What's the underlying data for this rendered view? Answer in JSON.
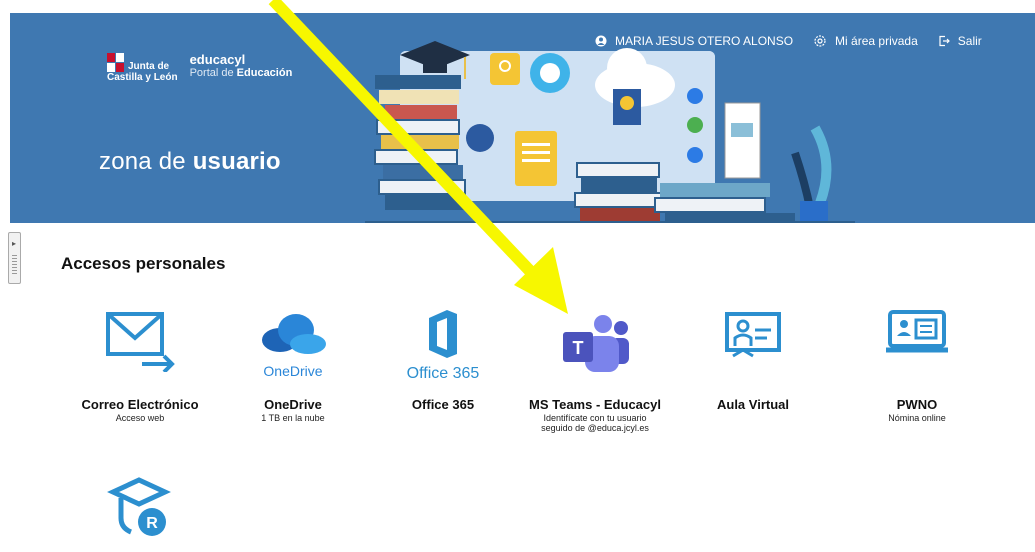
{
  "header": {
    "brand_line1": "Junta de",
    "brand_line2": "Castilla y León",
    "portal_name": "educacyl",
    "portal_sub_prefix": "Portal de ",
    "portal_sub_bold": "Educación",
    "zona_prefix": "zona de ",
    "zona_bold": "usuario"
  },
  "topbar": {
    "user_name": "MARIA JESUS OTERO ALONSO",
    "private_area": "Mi área privada",
    "logout": "Salir"
  },
  "section": {
    "title": "Accesos personales"
  },
  "tiles": [
    {
      "name": "Correo Electrónico",
      "sub": "Acceso web",
      "icon": "mail-send-icon"
    },
    {
      "name": "OneDrive",
      "sub": "1 TB en la nube",
      "icon": "onedrive-icon",
      "icon_text": "OneDrive"
    },
    {
      "name": "Office 365",
      "sub": "",
      "icon": "office365-icon",
      "icon_text": "Office 365"
    },
    {
      "name": "MS Teams - Educacyl",
      "sub": "Identifícate con tu usuario seguido de @educa.jcyl.es",
      "icon": "teams-icon"
    },
    {
      "name": "Aula Virtual",
      "sub": "",
      "icon": "virtual-classroom-icon"
    },
    {
      "name": "PWNO",
      "sub": "Nómina online",
      "icon": "payroll-id-icon"
    },
    {
      "name": "",
      "sub": "",
      "icon": "graduation-r-icon"
    }
  ],
  "colors": {
    "banner": "#3f78b1",
    "icon_blue": "#2c8fcf",
    "teams": "#4b53bc",
    "annotation_arrow": "#f7f700"
  }
}
